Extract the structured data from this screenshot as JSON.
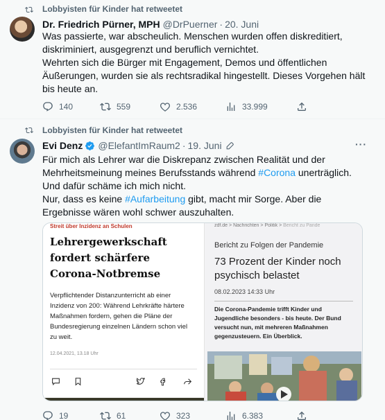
{
  "colors": {
    "accent": "#1d9bf0",
    "muted": "#536471",
    "verified": "#1d9bf0",
    "kicker_red": "#c0392b"
  },
  "tweets": [
    {
      "retweet_label": "Lobbyisten für Kinder hat retweetet",
      "author_name": "Dr. Friedrich Pürner, MPH",
      "handle": "@DrPuerner",
      "separator": "·",
      "date": "20. Juni",
      "more": "···",
      "text_lines": [
        "Was passierte, war abscheulich. Menschen wurden offen diskreditiert,",
        "diskriminiert, ausgegrenzt und beruflich vernichtet.",
        "Wehrten sich die Bürger mit Engagement, Demos und öffentlichen",
        "Äußerungen, wurden sie als rechtsradikal hingestellt. Dieses Vorgehen hält",
        "bis heute an."
      ],
      "replies": "140",
      "retweets": "559",
      "likes": "2.536",
      "views": "33.999"
    },
    {
      "retweet_label": "Lobbyisten für Kinder hat retweetet",
      "author_name": "Evi Denz",
      "handle": "@ElefantImRaum2",
      "separator": "·",
      "date": "19. Juni",
      "more": "···",
      "line1": "Für mich als Lehrer war die Diskrepanz zwischen Realität und der",
      "line2a": "Mehrheitsmeinung meines Berufsstands während ",
      "line2tag": "#Corona",
      "line2b": " unerträglich.",
      "line3": "Und dafür schäme ich mich nicht.",
      "line4a": "Nur, dass es keine ",
      "line4tag": "#Aufarbeitung",
      "line4b": " gibt, macht mir Sorge. Aber die",
      "line5": "Ergebnisse wären wohl schwer auszuhalten.",
      "replies": "19",
      "retweets": "61",
      "likes": "323",
      "views": "6.383",
      "card_left": {
        "kicker": "Streit über Inzidenz an Schulen",
        "headline": "Lehrergewerkschaft fordert schärfere Corona-Notbremse",
        "lead": "Verpflichtender Distanzunterricht ab einer Inzidenz von 200: Während Lehrkräfte härtere Maßnahmen fordern, gehen die Pläne der Bundesregierung einzelnen Ländern schon viel zu weit.",
        "timestamp": "12.04.2021, 13.18 Uhr"
      },
      "card_right": {
        "crumb1": "zdf.de",
        "crumb2": "Nachrichten",
        "crumb3": "Politik",
        "crumb4": "Bericht zu Pande",
        "crumb_sep": ">",
        "kicker": "Bericht zu Folgen der Pandemie",
        "title": "73 Prozent der Kinder noch psychisch belastet",
        "date": "08.02.2023 14:33 Uhr",
        "lead": "Die Corona-Pandemie trifft Kinder und Jugendliche besonders - bis heute. Der Bund versucht nun, mit mehreren Maßnahmen gegenzusteuern. Ein Überblick."
      }
    }
  ]
}
